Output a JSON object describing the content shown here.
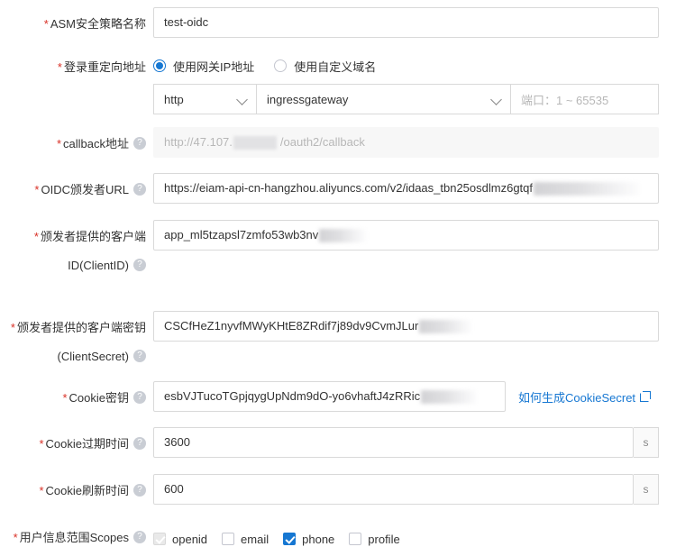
{
  "form": {
    "rows": [
      {
        "id": "policy-name",
        "required": true,
        "label": "ASM安全策略名称",
        "help": false,
        "value": "test-oidc"
      },
      {
        "id": "login-redirect",
        "required": true,
        "label": "登录重定向地址",
        "help": false,
        "radios": [
          {
            "label": "使用网关IP地址",
            "checked": true
          },
          {
            "label": "使用自定义域名",
            "checked": false
          }
        ],
        "protocol": "http",
        "gateway": "ingressgateway",
        "port_placeholder": "端口：1 ~ 65535"
      },
      {
        "id": "callback-address",
        "required": true,
        "label": "callback地址",
        "help": true,
        "disabled": true,
        "value_prefix": "http://47.107.",
        "value_suffix": "/oauth2/callback"
      },
      {
        "id": "oidc-issuer-url",
        "required": true,
        "label": "OIDC颁发者URL",
        "help": true,
        "value": "https://eiam-api-cn-hangzhou.aliyuncs.com/v2/idaas_tbn25osdlmz6gtqf"
      },
      {
        "id": "client-id",
        "required": true,
        "label_line1": "颁发者提供的客户端",
        "label_line2": "ID(ClientID)",
        "help": true,
        "value": "app_ml5tzapsl7zmfo53wb3nv"
      },
      {
        "id": "client-secret",
        "required": true,
        "label_line1": "颁发者提供的客户端密钥",
        "label_line2": "(ClientSecret)",
        "help": true,
        "value": "CSCfHeZ1nyvfMWyKHtE8ZRdif7j89dv9CvmJLur"
      },
      {
        "id": "cookie-secret",
        "required": true,
        "label": "Cookie密钥",
        "help": true,
        "value": "esbVJTucoTGpjqygUpNdm9dO-yo6vhaftJ4zRRic",
        "link_text": "如何生成CookieSecret"
      },
      {
        "id": "cookie-expire",
        "required": true,
        "label": "Cookie过期时间",
        "help": true,
        "value": "3600",
        "suffix": "s"
      },
      {
        "id": "cookie-refresh",
        "required": true,
        "label": "Cookie刷新时间",
        "help": true,
        "value": "600",
        "suffix": "s"
      },
      {
        "id": "scopes",
        "required": true,
        "label": "用户信息范围Scopes",
        "help": true,
        "checkboxes": [
          {
            "label": "openid",
            "checked": true,
            "disabled": true
          },
          {
            "label": "email",
            "checked": false,
            "disabled": false
          },
          {
            "label": "phone",
            "checked": true,
            "disabled": false
          },
          {
            "label": "profile",
            "checked": false,
            "disabled": false
          }
        ]
      }
    ],
    "help_glyph": "?",
    "required_glyph": "*",
    "colors": {
      "accent": "#1677d2",
      "required": "#d93026",
      "border": "#d9d9d9",
      "text": "#333333",
      "placeholder": "#b7b7b7",
      "disabled_bg": "#f7f7f7"
    }
  }
}
